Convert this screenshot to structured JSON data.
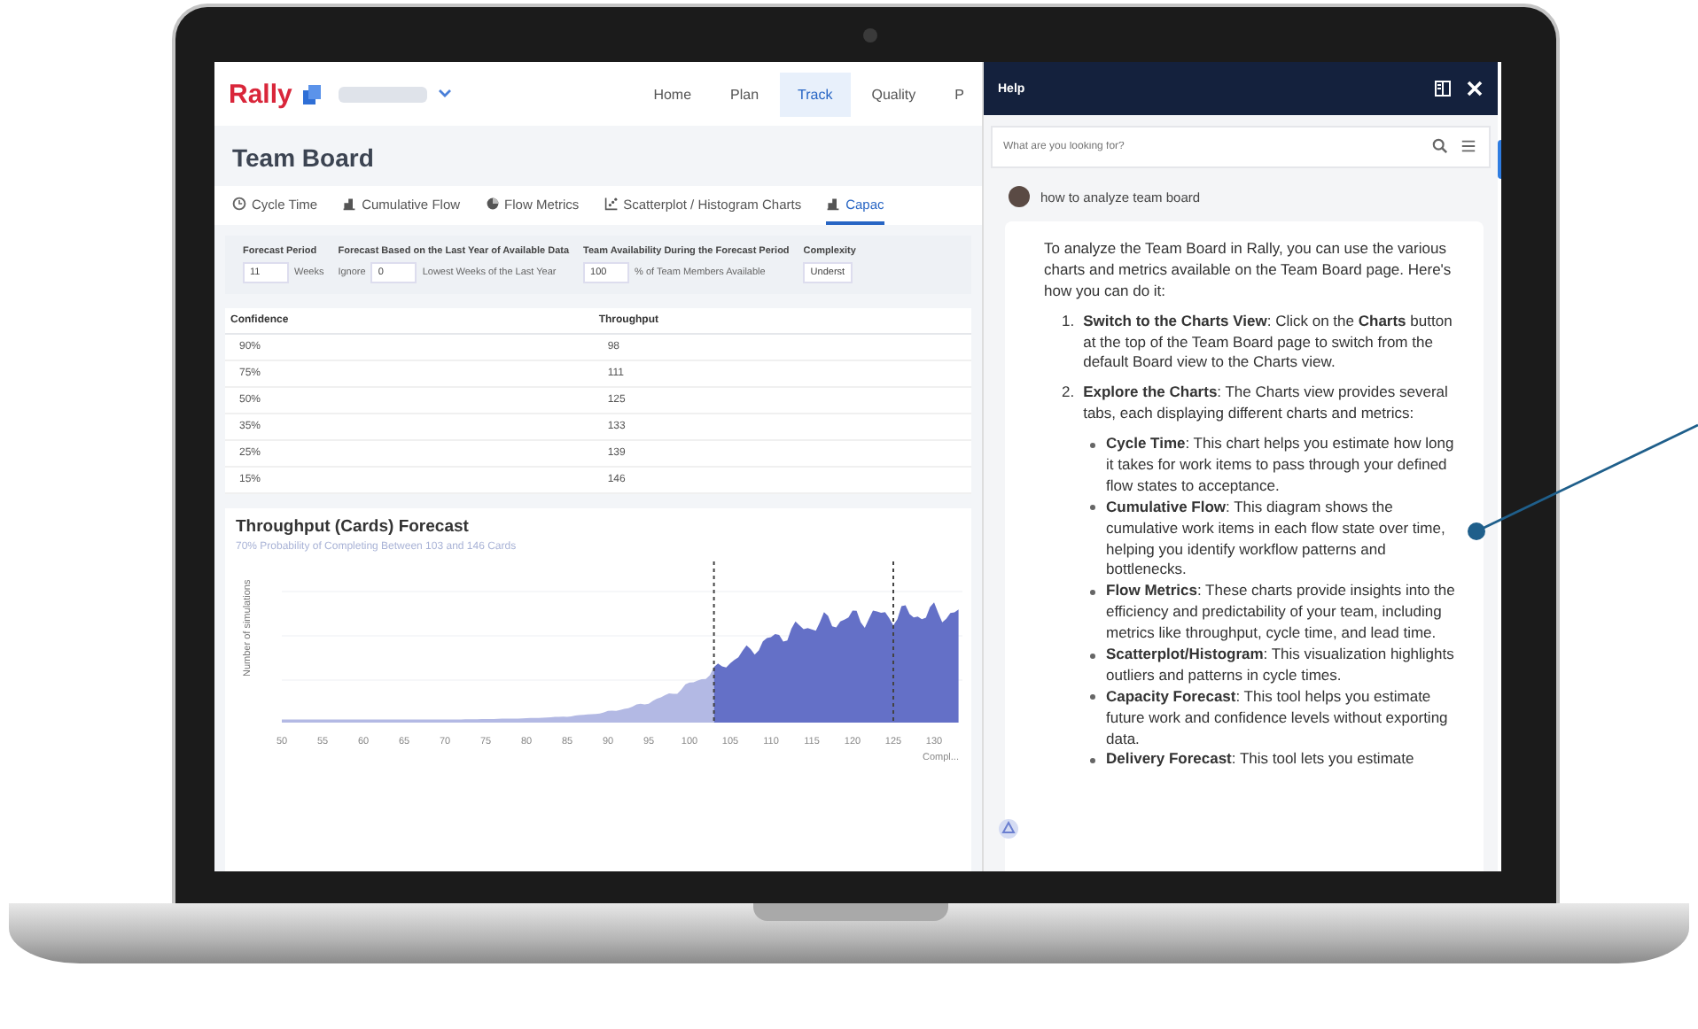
{
  "app": {
    "logo": "Rally",
    "nav": [
      {
        "label": "Home",
        "selected": false
      },
      {
        "label": "Plan",
        "selected": false
      },
      {
        "label": "Track",
        "selected": true
      },
      {
        "label": "Quality",
        "selected": false
      },
      {
        "label": "P",
        "selected": false
      }
    ],
    "page_title": "Team Board",
    "tabs": [
      {
        "label": "Cycle Time",
        "selected": false
      },
      {
        "label": "Cumulative Flow",
        "selected": false
      },
      {
        "label": "Flow Metrics",
        "selected": false
      },
      {
        "label": "Scatterplot / Histogram Charts",
        "selected": false
      },
      {
        "label": "Capac",
        "selected": true
      }
    ],
    "filters": [
      {
        "label": "Forecast Period",
        "parts": [
          {
            "kind": "input",
            "text": "11"
          },
          {
            "kind": "text",
            "text": "Weeks"
          }
        ]
      },
      {
        "label": "Forecast Based on the Last Year of Available Data",
        "parts": [
          {
            "kind": "text",
            "text": "Ignore"
          },
          {
            "kind": "input",
            "text": "0"
          },
          {
            "kind": "text",
            "text": "Lowest Weeks of the Last Year"
          }
        ]
      },
      {
        "label": "Team Availability During the Forecast Period",
        "parts": [
          {
            "kind": "input",
            "text": "100"
          },
          {
            "kind": "text",
            "text": "% of Team Members Available"
          }
        ]
      },
      {
        "label": "Complexity",
        "parts": [
          {
            "kind": "select",
            "text": "Underst"
          }
        ]
      }
    ],
    "table": {
      "columns": [
        "Confidence",
        "Throughput"
      ],
      "rows": [
        [
          "90%",
          "98"
        ],
        [
          "75%",
          "111"
        ],
        [
          "50%",
          "125"
        ],
        [
          "35%",
          "133"
        ],
        [
          "25%",
          "139"
        ],
        [
          "15%",
          "146"
        ]
      ]
    },
    "forecast": {
      "title": "Throughput (Cards) Forecast",
      "subtitle": "70% Probability of Completing Between 103 and 146 Cards",
      "ylabel": "Number of simulations",
      "xlabel": "Compl...",
      "xticks": [
        "50",
        "55",
        "60",
        "65",
        "70",
        "75",
        "80",
        "85",
        "90",
        "95",
        "100",
        "105",
        "110",
        "115",
        "120",
        "125",
        "130"
      ]
    }
  },
  "help": {
    "title": "Help",
    "search": {
      "placeholder": "What are you looking for?"
    },
    "question": "how to analyze team board",
    "answer": {
      "intro": "To analyze the Team Board in Rally, you can use the various charts and metrics available on the Team Board page. Here's how you can do it:",
      "steps": [
        {
          "number": "1.",
          "text": "**Switch to the Charts View**: Click on the **Charts** button at the top of the Team Board page to switch from the default Board view to the Charts view."
        },
        {
          "number": "2.",
          "text": "**Explore the Charts**: The Charts view provides several tabs, each displaying different charts and metrics:",
          "children": [
            {
              "text": "**Cycle Time**: This chart helps you estimate how long it takes for work items to pass through your defined flow states to acceptance."
            },
            {
              "text": "**Cumulative Flow**: This diagram shows the cumulative work items in each flow state over time, helping you identify workflow patterns and bottlenecks."
            },
            {
              "text": "**Flow Metrics**: These charts provide insights into the efficiency and predictability of your team, including metrics like throughput, cycle time, and lead time."
            },
            {
              "text": "**Scatterplot/Histogram**: This visualization highlights outliers and patterns in cycle times."
            },
            {
              "text": "**Capacity Forecast**: This tool helps you estimate future work and confidence levels without exporting data."
            },
            {
              "text": "**Delivery Forecast**: This tool lets you estimate"
            }
          ]
        }
      ]
    }
  }
}
